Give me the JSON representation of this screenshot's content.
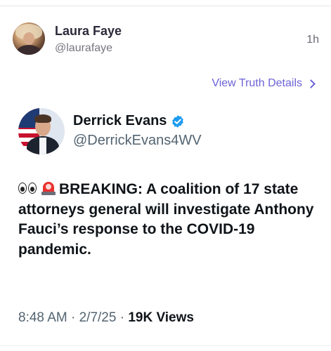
{
  "truth": {
    "display_name": "Laura Faye",
    "handle": "@laurafaye",
    "time": "1h",
    "view_details_label": "View Truth Details"
  },
  "tweet": {
    "display_name": "Derrick Evans",
    "handle": "@DerrickEvans4WV",
    "verified": true,
    "emojis": [
      "eyes",
      "police-car-light"
    ],
    "text": "BREAKING: A coalition of 17 state attorneys general will investigate Anthony Fauci’s response to the COVID-19 pandemic.",
    "timestamp": "8:48 AM · 2/7/25 · ",
    "views_count": "19K",
    "views_label": "Views"
  },
  "colors": {
    "link_purple": "#6c63d6",
    "verified_blue": "#1d9bf0",
    "muted_text": "#536471"
  }
}
